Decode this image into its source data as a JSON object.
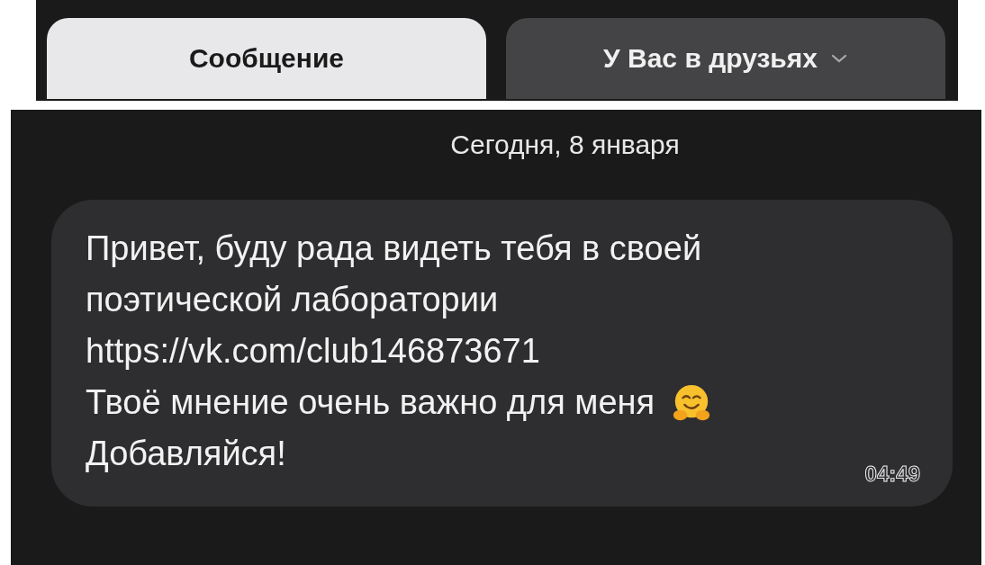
{
  "actions": [
    {
      "label": "Сообщение",
      "kind": "primary",
      "caret": false
    },
    {
      "label": "У Вас в друзьях",
      "kind": "secondary",
      "caret": true
    }
  ],
  "date_separator": "Сегодня, 8 января",
  "message": {
    "parts": [
      {
        "kind": "text",
        "text": "Привет, буду рада видеть тебя в своей поэтической лаборатории"
      },
      {
        "kind": "link",
        "text": "https://vk.com/club146873671"
      },
      {
        "kind": "text",
        "text": "Твоё мнение очень важно для меня",
        "emoji": true
      },
      {
        "kind": "text",
        "text": "Добавляйся!"
      }
    ],
    "time": "04:49"
  }
}
